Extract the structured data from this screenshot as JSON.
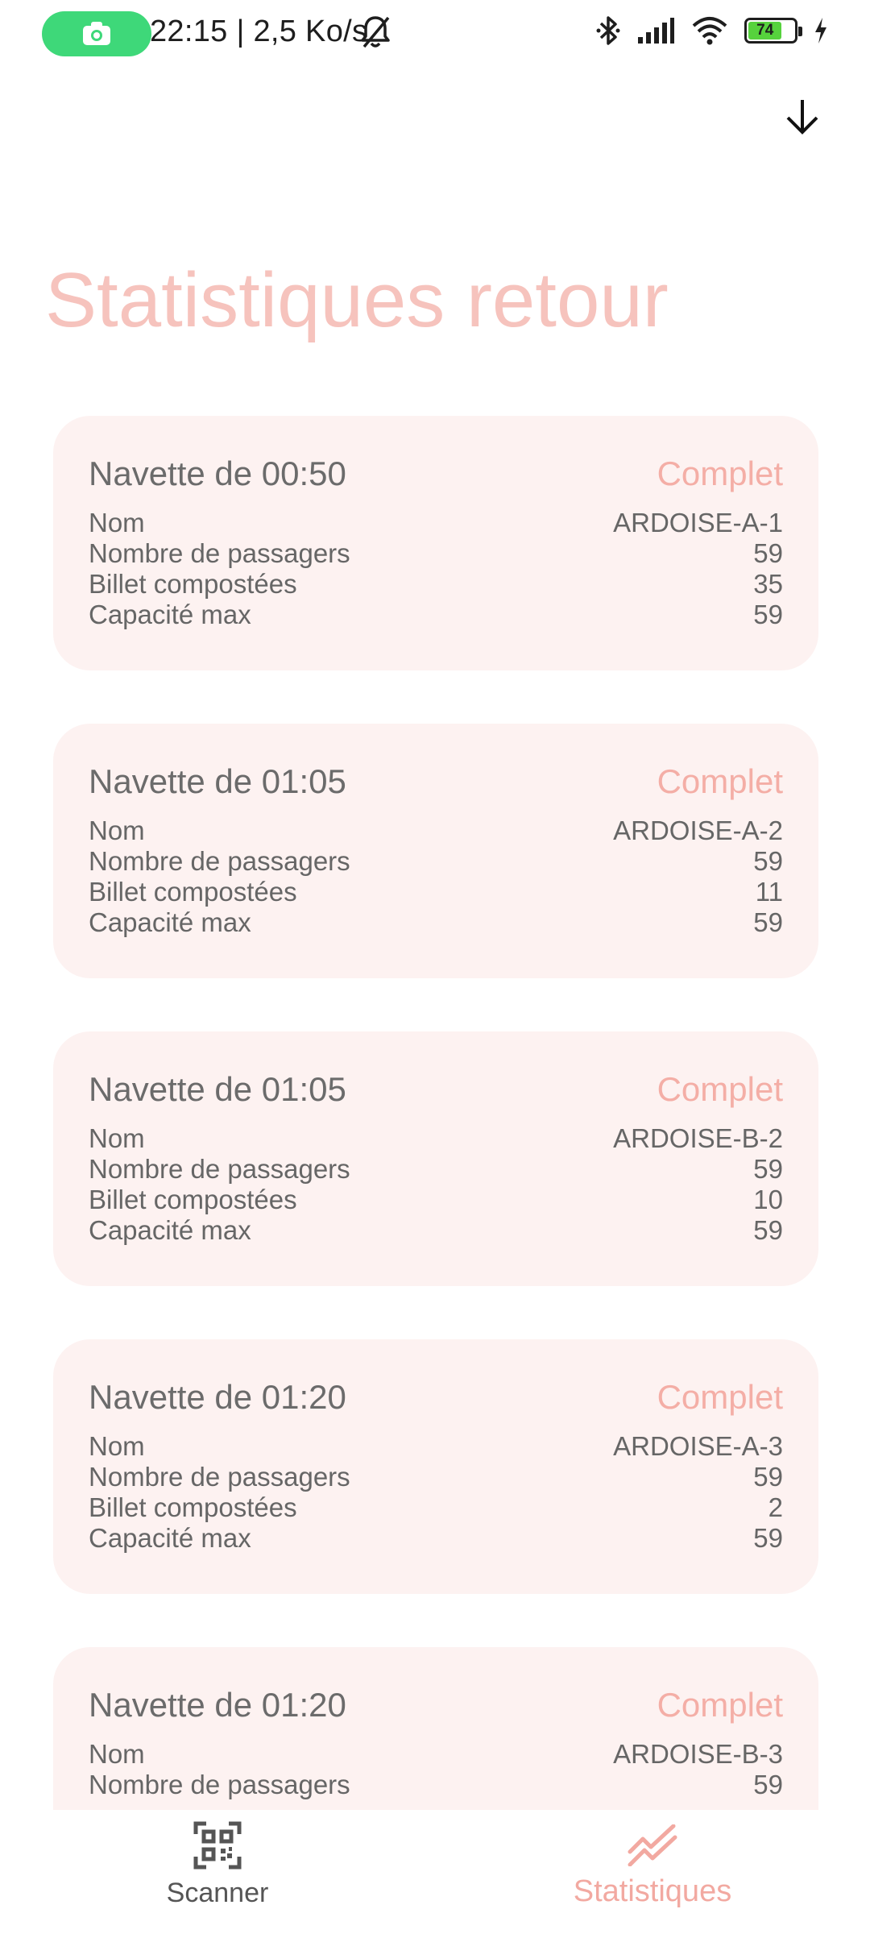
{
  "status_bar": {
    "time_and_speed": "22:15 | 2,5 Ko/s",
    "battery_level": "74",
    "accent_color": "#3ed879"
  },
  "header": {
    "title": "Statistiques retour",
    "title_color": "#f6c3bd"
  },
  "labels": {
    "name": "Nom",
    "passengers": "Nombre de passagers",
    "tickets": "Billet compostées",
    "capacity": "Capacité max"
  },
  "shuttles": [
    {
      "title": "Navette de 00:50",
      "status": "Complet",
      "name": "ARDOISE-A-1",
      "passengers": "59",
      "tickets": "35",
      "capacity": "59"
    },
    {
      "title": "Navette de 01:05",
      "status": "Complet",
      "name": "ARDOISE-A-2",
      "passengers": "59",
      "tickets": "11",
      "capacity": "59"
    },
    {
      "title": "Navette de 01:05",
      "status": "Complet",
      "name": "ARDOISE-B-2",
      "passengers": "59",
      "tickets": "10",
      "capacity": "59"
    },
    {
      "title": "Navette de 01:20",
      "status": "Complet",
      "name": "ARDOISE-A-3",
      "passengers": "59",
      "tickets": "2",
      "capacity": "59"
    },
    {
      "title": "Navette de 01:20",
      "status": "Complet",
      "name": "ARDOISE-B-3",
      "passengers": "59"
    }
  ],
  "bottom_nav": {
    "scanner_label": "Scanner",
    "stats_label": "Statistiques",
    "active_color": "#f2a9a1",
    "scanner_icon": "qr-code-icon",
    "stats_icon": "trending-chart-icon"
  }
}
